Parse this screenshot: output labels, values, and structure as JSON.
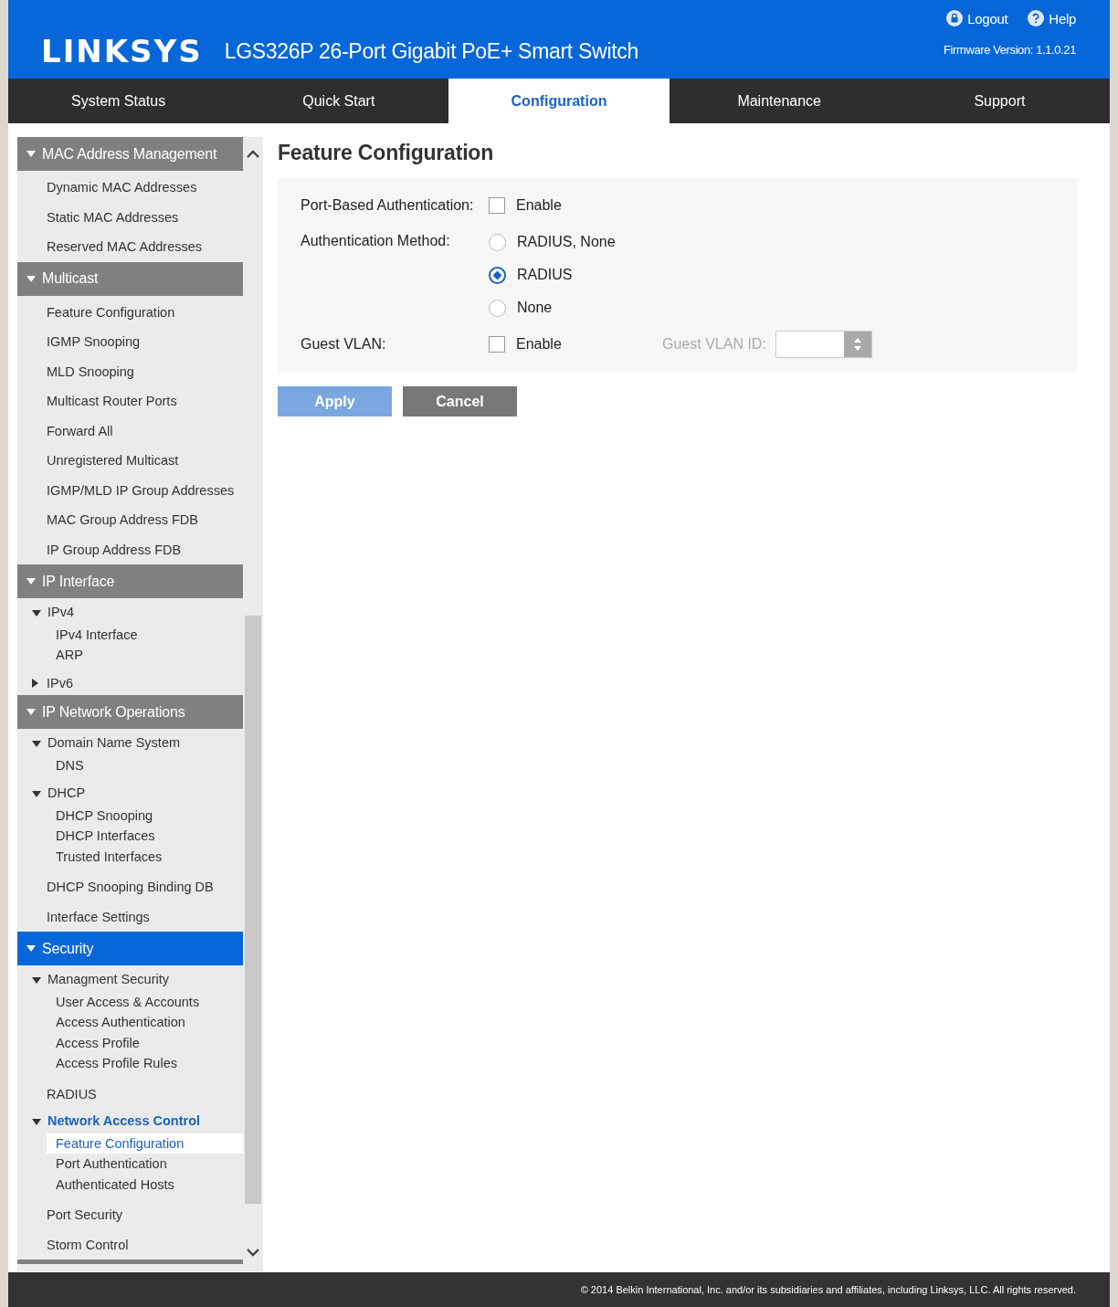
{
  "header": {
    "logo": "LINKSYS",
    "product": "LGS326P 26-Port Gigabit PoE+ Smart Switch",
    "links": [
      {
        "label": "Logout",
        "kind": "logout"
      },
      {
        "label": "Help",
        "kind": "help"
      }
    ],
    "firmware": "Firmware Version: 1.1.0.21"
  },
  "tabs": [
    {
      "label": "System Status",
      "selected": false
    },
    {
      "label": "Quick Start",
      "selected": false
    },
    {
      "label": "Configuration",
      "selected": true
    },
    {
      "label": "Maintenance",
      "selected": false
    },
    {
      "label": "Support",
      "selected": false
    }
  ],
  "sidebar": {
    "sections": [
      {
        "title": "MAC Address Management",
        "expanded": true,
        "selected": false,
        "items": [
          {
            "label": "Dynamic MAC Addresses",
            "kind": "link",
            "selected": false
          },
          {
            "label": "Static MAC Addresses",
            "kind": "link",
            "selected": false
          },
          {
            "label": "Reserved MAC Addresses",
            "kind": "link",
            "selected": false
          }
        ]
      },
      {
        "title": "Multicast",
        "expanded": true,
        "selected": false,
        "items": [
          {
            "label": "Feature Configuration",
            "kind": "link",
            "selected": false
          },
          {
            "label": "IGMP Snooping",
            "kind": "link",
            "selected": false
          },
          {
            "label": "MLD Snooping",
            "kind": "link",
            "selected": false
          },
          {
            "label": "Multicast Router Ports",
            "kind": "link",
            "selected": false
          },
          {
            "label": "Forward All",
            "kind": "link",
            "selected": false
          },
          {
            "label": "Unregistered Multicast",
            "kind": "link",
            "selected": false
          },
          {
            "label": "IGMP/MLD IP Group Addresses",
            "kind": "link",
            "selected": false
          },
          {
            "label": "MAC Group Address FDB",
            "kind": "link",
            "selected": false
          },
          {
            "label": "IP Group Address FDB",
            "kind": "link",
            "selected": false
          }
        ]
      },
      {
        "title": "IP Interface",
        "expanded": true,
        "selected": false,
        "items": [
          {
            "label": "IPv4",
            "kind": "group",
            "selected": false,
            "expanded": true,
            "children": [
              {
                "label": "IPv4 Interface",
                "selected": false
              },
              {
                "label": "ARP",
                "selected": false
              }
            ]
          },
          {
            "label": "IPv6",
            "kind": "group",
            "selected": false,
            "expanded": false
          }
        ]
      },
      {
        "title": "IP Network Operations",
        "expanded": true,
        "selected": false,
        "items": [
          {
            "label": "Domain Name System",
            "kind": "group",
            "selected": false,
            "expanded": true,
            "children": [
              {
                "label": "DNS",
                "selected": false
              }
            ]
          },
          {
            "label": "DHCP",
            "kind": "group",
            "selected": false,
            "expanded": true,
            "children": [
              {
                "label": "DHCP Snooping",
                "selected": false
              },
              {
                "label": "DHCP Interfaces",
                "selected": false
              },
              {
                "label": "Trusted Interfaces",
                "selected": false
              }
            ]
          },
          {
            "label": "DHCP Snooping Binding DB",
            "kind": "link",
            "selected": false
          },
          {
            "label": "Interface Settings",
            "kind": "link",
            "selected": false
          }
        ]
      },
      {
        "title": "Security",
        "expanded": true,
        "selected": true,
        "items": [
          {
            "label": "Managment Security",
            "kind": "group",
            "selected": false,
            "expanded": true,
            "children": [
              {
                "label": "User Access & Accounts",
                "selected": false
              },
              {
                "label": "Access Authentication",
                "selected": false
              },
              {
                "label": "Access Profile",
                "selected": false
              },
              {
                "label": "Access Profile Rules",
                "selected": false
              }
            ]
          },
          {
            "label": "RADIUS",
            "kind": "link",
            "selected": false
          },
          {
            "label": "Network Access Control",
            "kind": "group",
            "selected": true,
            "expanded": true,
            "children": [
              {
                "label": "Feature Configuration",
                "selected": true
              },
              {
                "label": "Port Authentication",
                "selected": false
              },
              {
                "label": "Authenticated Hosts",
                "selected": false
              }
            ]
          },
          {
            "label": "Port Security",
            "kind": "link",
            "selected": false
          },
          {
            "label": "Storm Control",
            "kind": "link",
            "selected": false
          }
        ]
      }
    ]
  },
  "page": {
    "title": "Feature Configuration",
    "port_based_authentication": {
      "label": "Port-Based Authentication:",
      "option": "Enable",
      "checked": false
    },
    "authentication_method": {
      "label": "Authentication Method:",
      "options": [
        {
          "label": "RADIUS, None",
          "selected": false
        },
        {
          "label": "RADIUS",
          "selected": true
        },
        {
          "label": "None",
          "selected": false
        }
      ]
    },
    "guest_vlan": {
      "label": "Guest VLAN:",
      "option": "Enable",
      "checked": false,
      "id_label": "Guest VLAN ID:",
      "id_disabled": true
    },
    "buttons": [
      {
        "label": "Apply",
        "kind": "primary"
      },
      {
        "label": "Cancel",
        "kind": "secondary"
      }
    ]
  },
  "footer": "© 2014 Belkin International, Inc. and/or its subsidiaries and affiliates, including Linksys, LLC. All rights reserved."
}
